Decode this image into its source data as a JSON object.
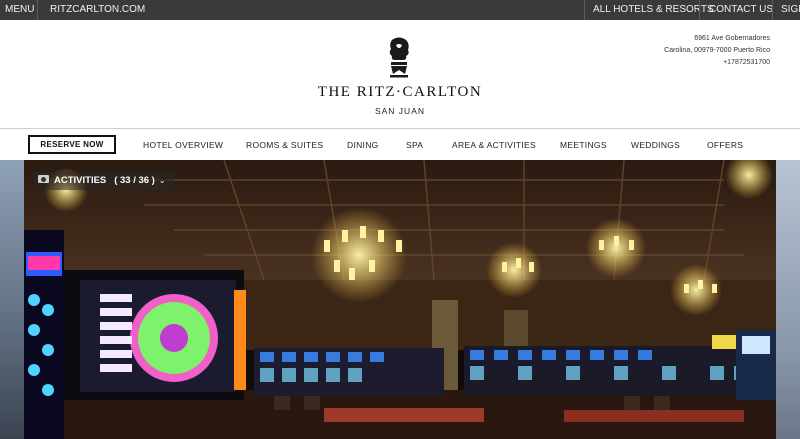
{
  "topbar": {
    "menu": "MENU",
    "site": "RITZCARLTON.COM",
    "all_hotels": "ALL HOTELS & RESORTS",
    "contact": "CONTACT US",
    "sign": "SIGN"
  },
  "header": {
    "brand": "THE RITZ·CARLTON",
    "location": "SAN JUAN",
    "address_line1": "6961 Ave Gobernadores",
    "address_line2": "Carolina, 00979-7000 Puerto Rico",
    "phone": "+17872531700"
  },
  "nav": {
    "reserve": "RESERVE NOW",
    "items": [
      "HOTEL OVERVIEW",
      "ROOMS & SUITES",
      "DINING",
      "SPA",
      "AREA & ACTIVITIES",
      "MEETINGS",
      "WEDDINGS",
      "OFFERS"
    ]
  },
  "gallery": {
    "label": "ACTIVITIES",
    "counter": "( 33 / 36 )",
    "icon": "camera-icon"
  },
  "colors": {
    "topbar_bg": "#3a3a3a",
    "text_dark": "#111111"
  }
}
